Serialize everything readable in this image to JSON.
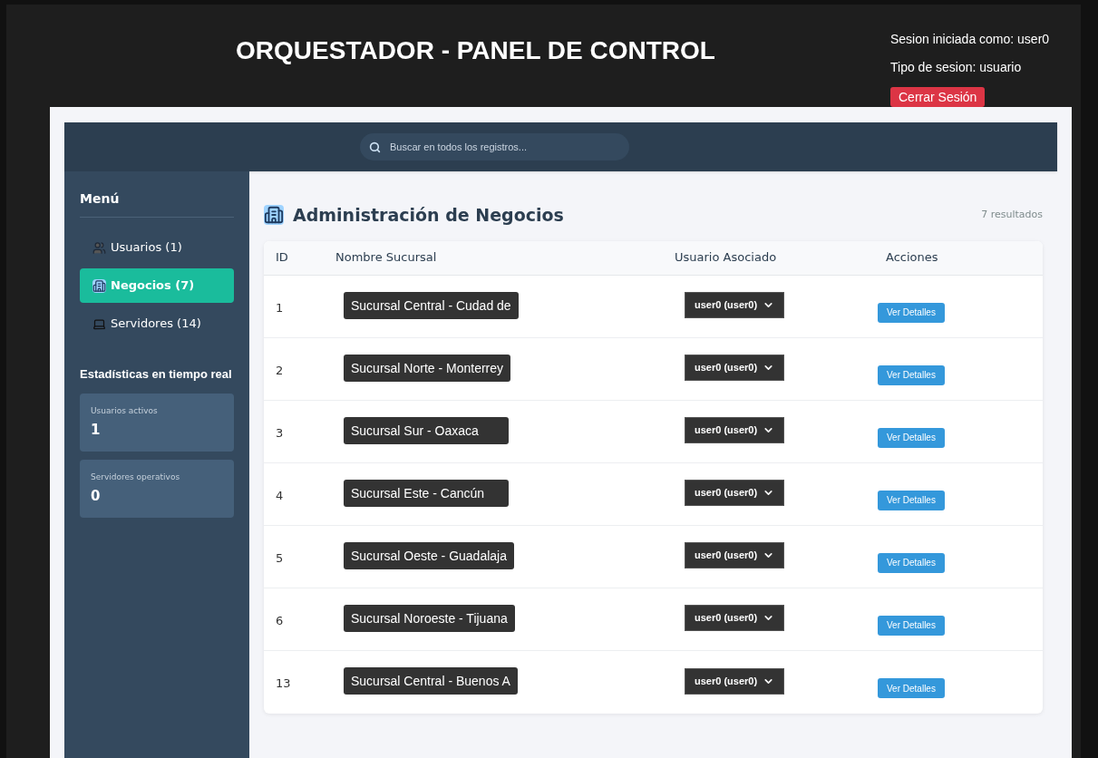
{
  "header": {
    "title": "ORQUESTADOR - PANEL DE CONTROL",
    "session_user": "Sesion iniciada como: user0",
    "session_type": "Tipo de sesion: usuario",
    "logout": "Cerrar Sesión"
  },
  "search": {
    "placeholder": "Buscar en todos los registros..."
  },
  "sidebar": {
    "title": "Menú",
    "items": [
      {
        "kind": "users",
        "label": "Usuarios (1)",
        "selected": false
      },
      {
        "kind": "business",
        "label": "Negocios (7)",
        "selected": true
      },
      {
        "kind": "servers",
        "label": "Servidores (14)",
        "selected": false
      }
    ],
    "stats_title": "Estadísticas en tiempo real",
    "stats": [
      {
        "label": "Usuarios activos",
        "value": "1"
      },
      {
        "label": "Servidores operativos",
        "value": "0"
      }
    ]
  },
  "main": {
    "title": "Administración de Negocios",
    "count": "7 resultados",
    "table": {
      "columns": [
        "ID",
        "Nombre Sucursal",
        "Usuario Asociado",
        "Acciones"
      ],
      "rows": [
        {
          "id": "1",
          "name": "Sucursal Central - Cudad de",
          "user": "user0 (user0)",
          "action": "Ver Detalles"
        },
        {
          "id": "2",
          "name": "Sucursal Norte - Monterrey",
          "user": "user0 (user0)",
          "action": "Ver Detalles"
        },
        {
          "id": "3",
          "name": "Sucursal Sur - Oaxaca",
          "user": "user0 (user0)",
          "action": "Ver Detalles"
        },
        {
          "id": "4",
          "name": "Sucursal Este - Cancún",
          "user": "user0 (user0)",
          "action": "Ver Detalles"
        },
        {
          "id": "5",
          "name": "Sucursal Oeste - Guadalaja",
          "user": "user0 (user0)",
          "action": "Ver Detalles"
        },
        {
          "id": "6",
          "name": "Sucursal Noroeste - Tijuana",
          "user": "user0 (user0)",
          "action": "Ver Detalles"
        },
        {
          "id": "13",
          "name": "Sucursal Central - Buenos A",
          "user": "user0 (user0)",
          "action": "Ver Detalles"
        }
      ]
    }
  }
}
